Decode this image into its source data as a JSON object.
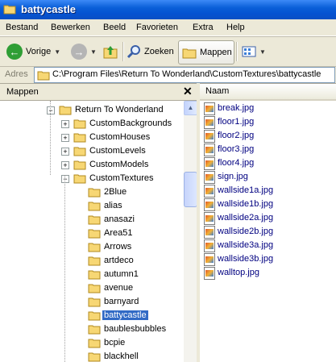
{
  "window": {
    "title": "battycastle"
  },
  "menu": [
    "Bestand",
    "Bewerken",
    "Beeld",
    "Favorieten",
    "Extra",
    "Help"
  ],
  "toolbar": {
    "back_label": "Vorige",
    "search_label": "Zoeken",
    "folders_label": "Mappen"
  },
  "address": {
    "label": "Adres",
    "path": "C:\\Program Files\\Return To Wonderland\\CustomTextures\\battycastle"
  },
  "folder_pane": {
    "title": "Mappen",
    "tree": [
      {
        "label": "Return To Wonderland",
        "level": 0,
        "toggle": "minus"
      },
      {
        "label": "CustomBackgrounds",
        "level": 1,
        "toggle": "plus"
      },
      {
        "label": "CustomHouses",
        "level": 1,
        "toggle": "plus"
      },
      {
        "label": "CustomLevels",
        "level": 1,
        "toggle": "plus"
      },
      {
        "label": "CustomModels",
        "level": 1,
        "toggle": "plus"
      },
      {
        "label": "CustomTextures",
        "level": 1,
        "toggle": "minus"
      },
      {
        "label": "2Blue",
        "level": 2,
        "toggle": "none"
      },
      {
        "label": "alias",
        "level": 2,
        "toggle": "none"
      },
      {
        "label": "anasazi",
        "level": 2,
        "toggle": "none"
      },
      {
        "label": "Area51",
        "level": 2,
        "toggle": "none"
      },
      {
        "label": "Arrows",
        "level": 2,
        "toggle": "none"
      },
      {
        "label": "artdeco",
        "level": 2,
        "toggle": "none"
      },
      {
        "label": "autumn1",
        "level": 2,
        "toggle": "none"
      },
      {
        "label": "avenue",
        "level": 2,
        "toggle": "none"
      },
      {
        "label": "barnyard",
        "level": 2,
        "toggle": "none"
      },
      {
        "label": "battycastle",
        "level": 2,
        "toggle": "none",
        "selected": true
      },
      {
        "label": "baublesbubbles",
        "level": 2,
        "toggle": "none"
      },
      {
        "label": "bcpie",
        "level": 2,
        "toggle": "none"
      },
      {
        "label": "blackhell",
        "level": 2,
        "toggle": "none"
      }
    ]
  },
  "file_pane": {
    "column_header": "Naam",
    "files": [
      "break.jpg",
      "floor1.jpg",
      "floor2.jpg",
      "floor3.jpg",
      "floor4.jpg",
      "sign.jpg",
      "wallside1a.jpg",
      "wallside1b.jpg",
      "wallside2a.jpg",
      "wallside2b.jpg",
      "wallside3a.jpg",
      "wallside3b.jpg",
      "walltop.jpg"
    ]
  },
  "colors": {
    "title_bar": "#0553d1",
    "selection": "#316ac5",
    "file_text": "#000080",
    "folder": "#f7d774"
  }
}
